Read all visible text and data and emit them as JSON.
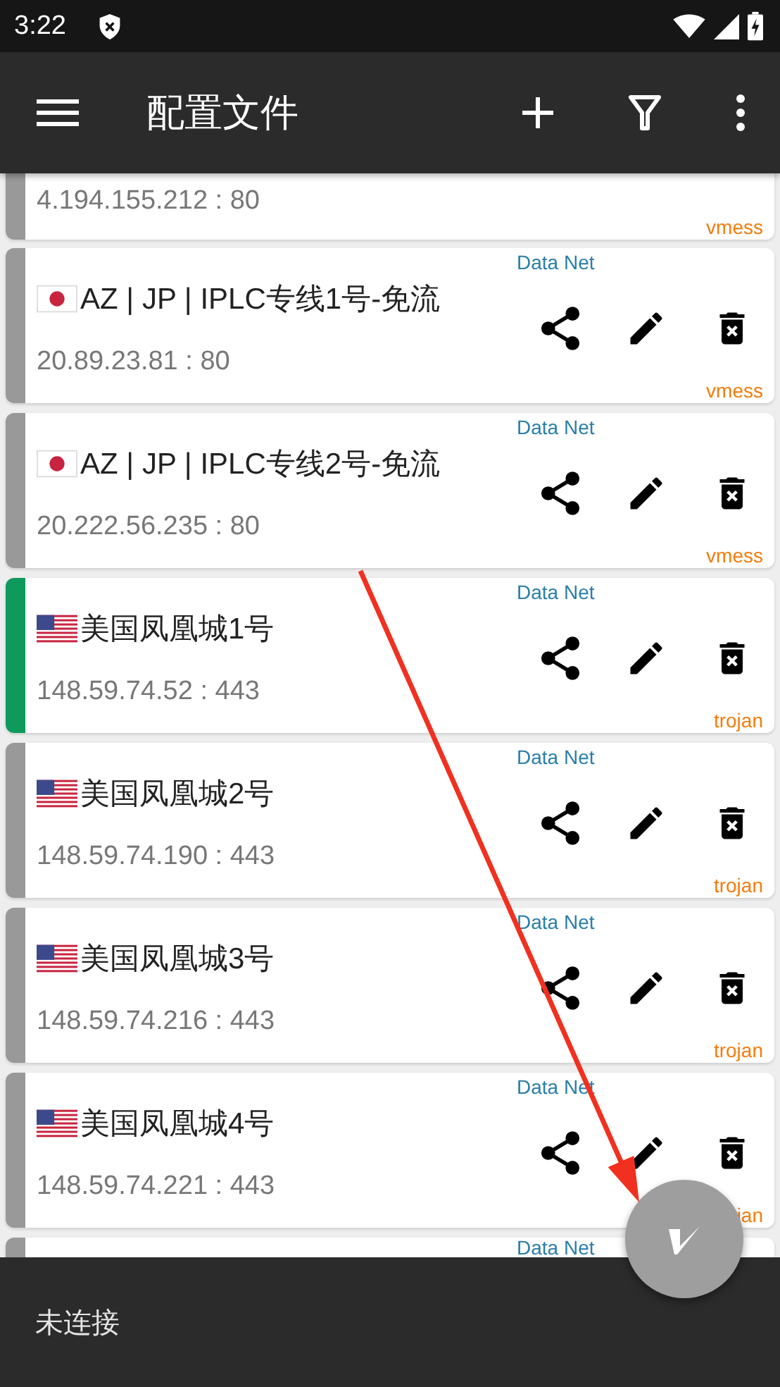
{
  "status_bar": {
    "time": "3:22"
  },
  "app_bar": {
    "title": "配置文件"
  },
  "profiles": [
    {
      "selected": false,
      "address": "4.194.155.212 : 80",
      "type": "vmess"
    },
    {
      "selected": false,
      "kind": "jp",
      "name": "AZ | JP | IPLC专线1号-免流",
      "address": "20.89.23.81 : 80",
      "network": "Data Net",
      "type": "vmess"
    },
    {
      "selected": false,
      "kind": "jp",
      "name": "AZ | JP | IPLC专线2号-免流",
      "address": "20.222.56.235 : 80",
      "network": "Data Net",
      "type": "vmess"
    },
    {
      "selected": true,
      "kind": "us",
      "name": "美国凤凰城1号",
      "address": "148.59.74.52 : 443",
      "network": "Data Net",
      "type": "trojan"
    },
    {
      "selected": false,
      "kind": "us",
      "name": "美国凤凰城2号",
      "address": "148.59.74.190 : 443",
      "network": "Data Net",
      "type": "trojan"
    },
    {
      "selected": false,
      "kind": "us",
      "name": "美国凤凰城3号",
      "address": "148.59.74.216 : 443",
      "network": "Data Net",
      "type": "trojan"
    },
    {
      "selected": false,
      "kind": "us",
      "name": "美国凤凰城4号",
      "address": "148.59.74.221 : 443",
      "network": "Data Net",
      "type": "jan"
    },
    {
      "selected": false,
      "network": "Data Net"
    }
  ],
  "bottom_bar": {
    "status": "未连接"
  },
  "annotation": {
    "kind": "arrow"
  }
}
